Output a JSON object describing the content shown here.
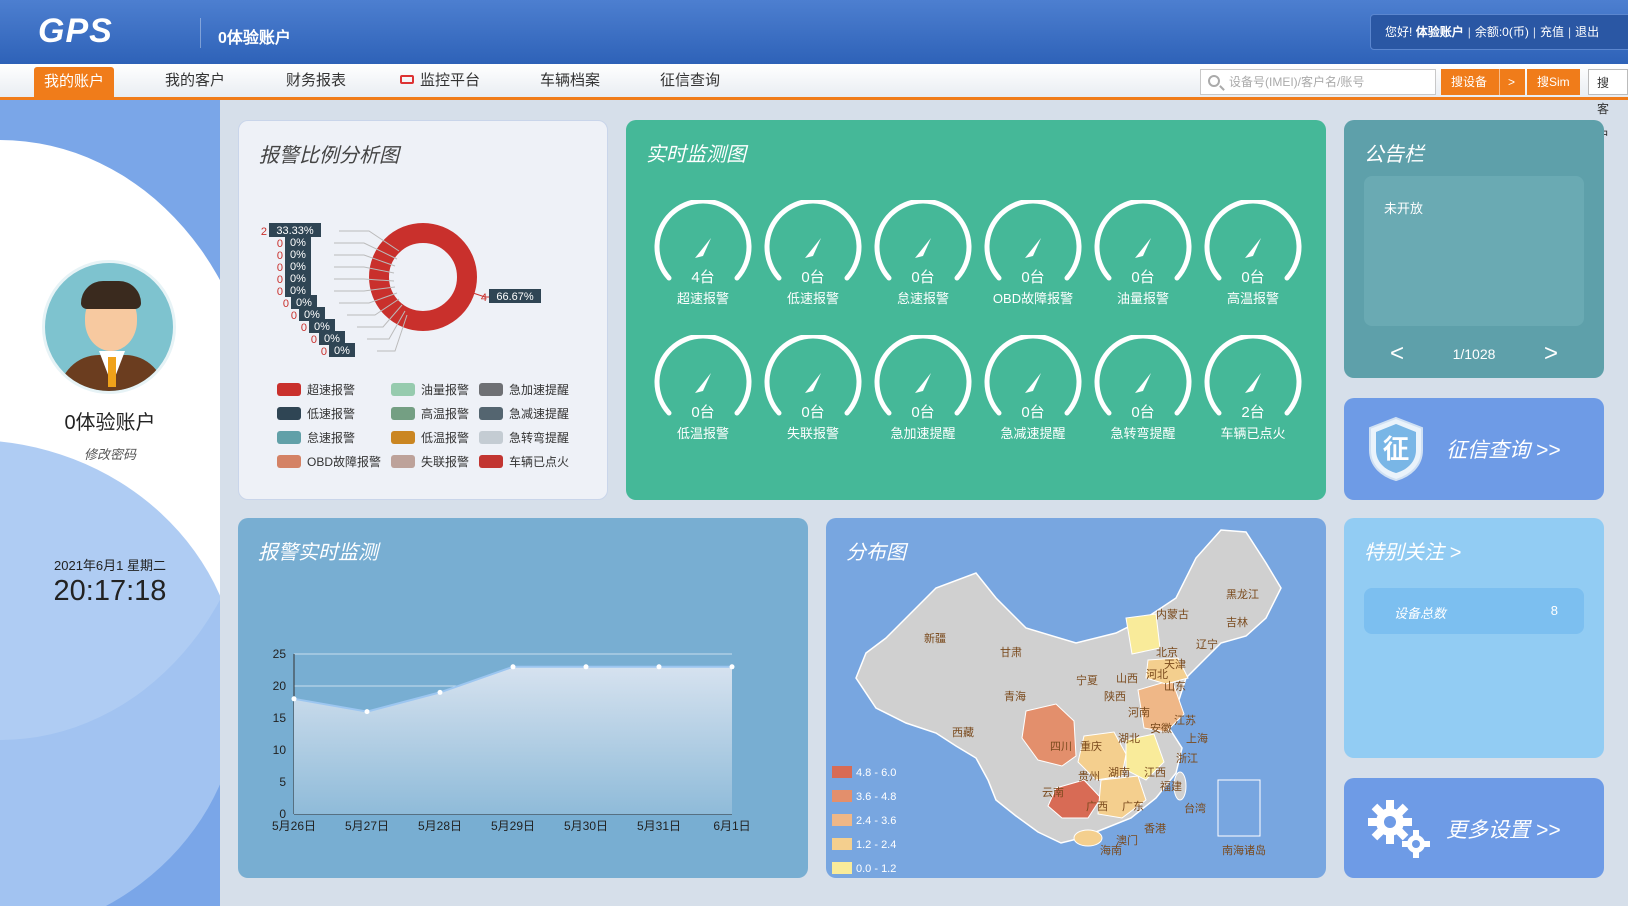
{
  "header": {
    "logo": "GPS",
    "account_title": "0体验账户",
    "greeting": "您好!",
    "user": "体验账户",
    "balance": "余额:0(币)",
    "recharge": "充值",
    "logout": "退出"
  },
  "nav": {
    "items": [
      {
        "label": "我的账户"
      },
      {
        "label": "我的客户"
      },
      {
        "label": "财务报表"
      },
      {
        "label": "监控平台"
      },
      {
        "label": "车辆档案"
      },
      {
        "label": "征信查询"
      }
    ],
    "search_placeholder": "设备号(IMEI)/客户名/账号",
    "btn_search_device": "搜设备",
    "btn_search_device_chevron": ">",
    "btn_search_sim": "搜Sim",
    "btn_search_customer": "搜客户"
  },
  "profile": {
    "username": "0体验账户",
    "change_password": "修改密码",
    "date": "2021年6月1 星期二",
    "time": "20:17:18"
  },
  "alarm_ratio": {
    "title": "报警比例分析图",
    "donut_labels": [
      {
        "count": "2",
        "pct": "33.33%"
      },
      {
        "count": "0",
        "pct": "0%"
      },
      {
        "count": "0",
        "pct": "0%"
      },
      {
        "count": "0",
        "pct": "0%"
      },
      {
        "count": "0",
        "pct": "0%"
      },
      {
        "count": "0",
        "pct": "0%"
      },
      {
        "count": "0",
        "pct": "0%"
      },
      {
        "count": "0",
        "pct": "0%"
      },
      {
        "count": "0",
        "pct": "0%"
      },
      {
        "count": "0",
        "pct": "0%"
      },
      {
        "count": "0",
        "pct": "0%"
      },
      {
        "count": "4",
        "pct": "66.67%"
      }
    ],
    "legend": [
      {
        "label": "超速报警",
        "color": "#c9302c"
      },
      {
        "label": "油量报警",
        "color": "#96cbae"
      },
      {
        "label": "急加速提醒",
        "color": "#6e7074"
      },
      {
        "label": "低速报警",
        "color": "#2f4554"
      },
      {
        "label": "高温报警",
        "color": "#749f83"
      },
      {
        "label": "急减速提醒",
        "color": "#546570"
      },
      {
        "label": "怠速报警",
        "color": "#61a0a8"
      },
      {
        "label": "低温报警",
        "color": "#ca8622"
      },
      {
        "label": "急转弯提醒",
        "color": "#c4ccd3"
      },
      {
        "label": "OBD故障报警",
        "color": "#d48265"
      },
      {
        "label": "失联报警",
        "color": "#bda29a"
      },
      {
        "label": "车辆已点火",
        "color": "#c23531"
      }
    ]
  },
  "realtime": {
    "title": "实时监测图",
    "gauges": [
      {
        "value": "4台",
        "label": "超速报警"
      },
      {
        "value": "0台",
        "label": "低速报警"
      },
      {
        "value": "0台",
        "label": "怠速报警"
      },
      {
        "value": "0台",
        "label": "OBD故障报警"
      },
      {
        "value": "0台",
        "label": "油量报警"
      },
      {
        "value": "0台",
        "label": "高温报警"
      },
      {
        "value": "0台",
        "label": "低温报警"
      },
      {
        "value": "0台",
        "label": "失联报警"
      },
      {
        "value": "0台",
        "label": "急加速提醒"
      },
      {
        "value": "0台",
        "label": "急减速提醒"
      },
      {
        "value": "0台",
        "label": "急转弯提醒"
      },
      {
        "value": "2台",
        "label": "车辆已点火"
      }
    ]
  },
  "notice": {
    "title": "公告栏",
    "content": "未开放",
    "pager": "1/1028",
    "prev": "<",
    "next": ">"
  },
  "credit": {
    "label": "征信查询 >>",
    "badge": "征"
  },
  "alarm_monitor": {
    "title": "报警实时监测"
  },
  "distribution": {
    "title": "分布图",
    "legend": [
      {
        "label": "4.8 - 6.0",
        "color": "#d86b55"
      },
      {
        "label": "3.6 - 4.8",
        "color": "#e38f6c"
      },
      {
        "label": "2.4 - 3.6",
        "color": "#efb787"
      },
      {
        "label": "1.2 - 2.4",
        "color": "#f4cf8e"
      },
      {
        "label": "0.0 - 1.2",
        "color": "#f9eb9a"
      }
    ],
    "provinces": [
      "黑龙江",
      "吉林",
      "内蒙古",
      "辽宁",
      "北京",
      "天津",
      "河北",
      "山西",
      "山东",
      "新疆",
      "甘肃",
      "宁夏",
      "陕西",
      "青海",
      "河南",
      "江苏",
      "安徽",
      "上海",
      "西藏",
      "湖北",
      "四川",
      "重庆",
      "浙江",
      "湖南",
      "江西",
      "贵州",
      "福建",
      "云南",
      "广西",
      "广东",
      "台湾",
      "香港",
      "澳门",
      "海南",
      "南海诸岛"
    ]
  },
  "focus": {
    "title": "特别关注 >",
    "row_label": "设备总数",
    "row_value": "8"
  },
  "more_settings": {
    "label": "更多设置 >>"
  },
  "chart_data": [
    {
      "type": "pie",
      "title": "报警比例分析图",
      "categories": [
        "超速报警",
        "低速报警",
        "怠速报警",
        "OBD故障报警",
        "油量报警",
        "高温报警",
        "低温报警",
        "失联报警",
        "急加速提醒",
        "急减速提醒",
        "急转弯提醒",
        "车辆已点火"
      ],
      "values": [
        2,
        0,
        0,
        0,
        0,
        0,
        0,
        0,
        0,
        0,
        0,
        4
      ],
      "percentages": [
        "33.33%",
        "0%",
        "0%",
        "0%",
        "0%",
        "0%",
        "0%",
        "0%",
        "0%",
        "0%",
        "0%",
        "66.67%"
      ],
      "donut": true
    },
    {
      "type": "area",
      "title": "报警实时监测",
      "categories": [
        "5月26日",
        "5月27日",
        "5月28日",
        "5月29日",
        "5月30日",
        "5月31日",
        "6月1日"
      ],
      "values": [
        18,
        16,
        19,
        23,
        23,
        23,
        23
      ],
      "yticks": [
        0,
        5,
        10,
        15,
        20,
        25
      ],
      "ylim": [
        0,
        25
      ],
      "grid": true
    }
  ]
}
